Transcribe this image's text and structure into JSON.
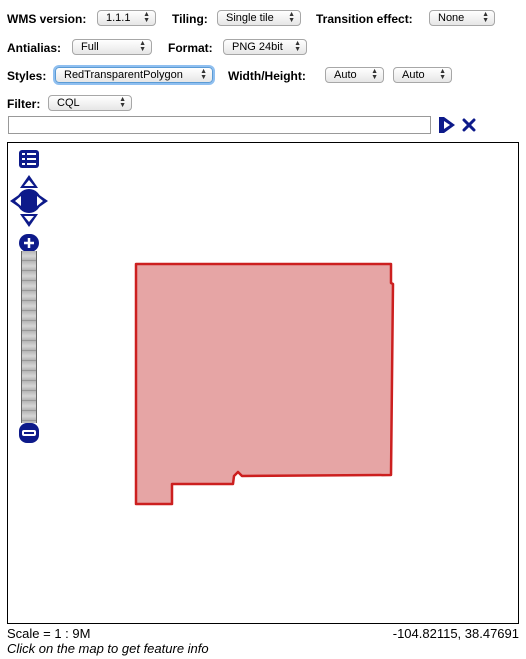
{
  "controls": {
    "wms_version": {
      "label": "WMS version:",
      "value": "1.1.1"
    },
    "tiling": {
      "label": "Tiling:",
      "value": "Single tile"
    },
    "transition": {
      "label": "Transition effect:",
      "value": "None"
    },
    "antialias": {
      "label": "Antialias:",
      "value": "Full"
    },
    "format": {
      "label": "Format:",
      "value": "PNG 24bit"
    },
    "styles": {
      "label": "Styles:",
      "value": "RedTransparentPolygon"
    },
    "width_height": {
      "label": "Width/Height:",
      "width_value": "Auto",
      "height_value": "Auto"
    },
    "filter": {
      "label": "Filter:",
      "value": "CQL",
      "input_value": ""
    }
  },
  "icons": {
    "apply": "play-triangle-icon",
    "reset": "close-x-icon",
    "layer_switcher": "list-icon",
    "pan": "pan-arrows-icon",
    "zoom_in": "plus-icon",
    "zoom_out": "minus-icon"
  },
  "colors": {
    "icon_blue": "#0d1a8a",
    "polygon_fill": "#e6a5a5",
    "polygon_stroke": "#cc1f1f",
    "focus_ring": "#8fbff0"
  },
  "status": {
    "scale": "Scale = 1 : 9M",
    "coordinates": "-104.82115, 38.47691",
    "hint": "Click on the map to get feature info"
  }
}
